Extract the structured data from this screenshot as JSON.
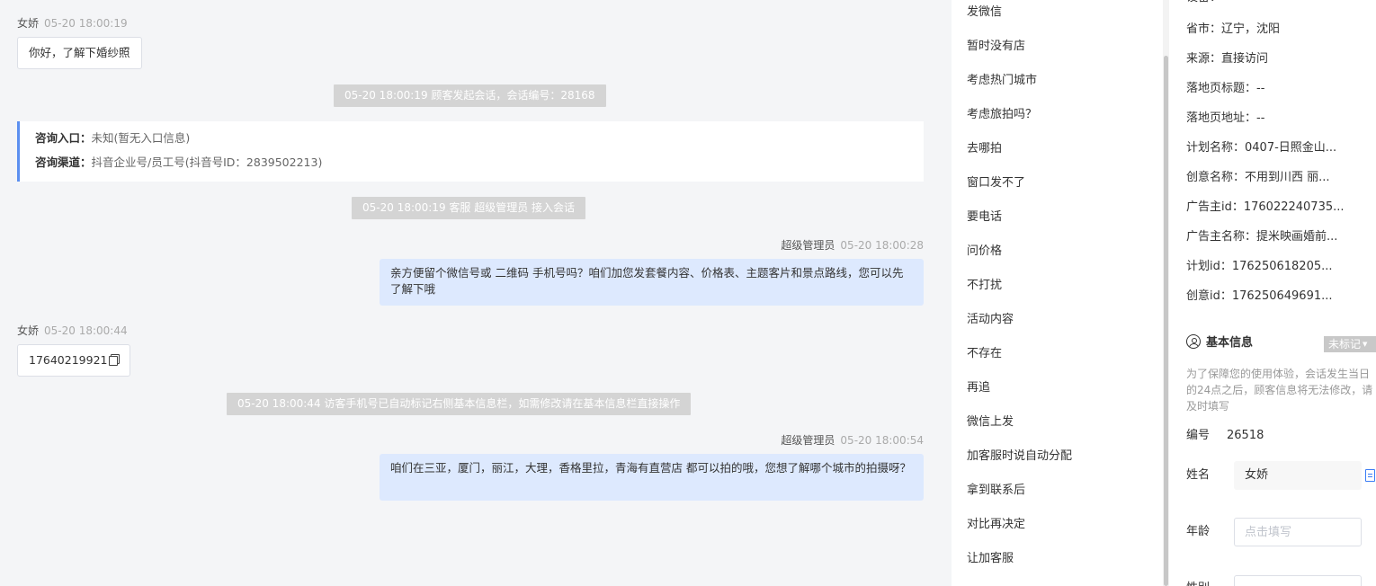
{
  "chat": {
    "msg1": {
      "sender": "女娇",
      "time": "05-20 18:00:19",
      "text": "你好，了解下婚纱照"
    },
    "sys1": "05-20 18:00:19 顾客发起会话，会话编号：28168",
    "entry_card": {
      "entry_key": "咨询入口：",
      "entry_value": "未知(暂无入口信息)",
      "channel_key": "咨询渠道：",
      "channel_value": "抖音企业号/员工号(抖音号ID：2839502213)"
    },
    "sys2": "05-20 18:00:19 客服 超级管理员 接入会话",
    "msg2": {
      "sender": "超级管理员",
      "time": "05-20 18:00:28",
      "text": "亲方便留个微信号或 二维码 手机号吗？咱们加您发套餐内容、价格表、主题客片和景点路线，您可以先了解下哦"
    },
    "msg3": {
      "sender": "女娇",
      "time": "05-20 18:00:44",
      "text": "17640219921",
      "icon": "copy-icon"
    },
    "sys3": "05-20 18:00:44 访客手机号已自动标记右侧基本信息栏，如需修改请在基本信息栏直接操作",
    "msg4": {
      "sender": "超级管理员",
      "time": "05-20 18:00:54",
      "text": "咱们在三亚，厦门，丽江，大理，香格里拉，青海有直营店 都可以拍的哦，您想了解哪个城市的拍摄呀？"
    }
  },
  "quick_replies": [
    "发微信",
    "暂时没有店",
    "考虑热门城市",
    "考虑旅拍吗？",
    "去哪拍",
    "窗口发不了",
    "要电话",
    "问价格",
    "不打扰",
    "活动内容",
    "不存在",
    "再追",
    "微信上发",
    "加客服时说自动分配",
    "拿到联系后",
    "对比再决定",
    "让加客服"
  ],
  "info_panel": {
    "clipped_top": "设备：--",
    "fields": [
      "省市：辽宁，沈阳",
      "来源：直接访问",
      "落地页标题：--",
      "落地页地址：--",
      "计划名称：0407-日照金山...",
      "创意名称：不用到川西 丽...",
      "广告主id：176022240735...",
      "广告主名称：提米映画婚前...",
      "计划id：176250618205...",
      "创意id：176250649691..."
    ],
    "basic_title": "基本信息",
    "tag_label": "未标记",
    "notice": "为了保障您的使用体验，会话发生当日的24点之后，顾客信息将无法修改，请及时填写",
    "id_label": "编号",
    "id_value": "26518",
    "name_label": "姓名",
    "name_value": "女娇",
    "age_label": "年龄",
    "age_placeholder": "点击填写",
    "clipped_label": "性别",
    "colors": {
      "accent": "#3b7df5",
      "bubble_agent": "#dde9fe",
      "card_border": "#5b8ff0",
      "sys_note": "#d4d4d4"
    }
  }
}
